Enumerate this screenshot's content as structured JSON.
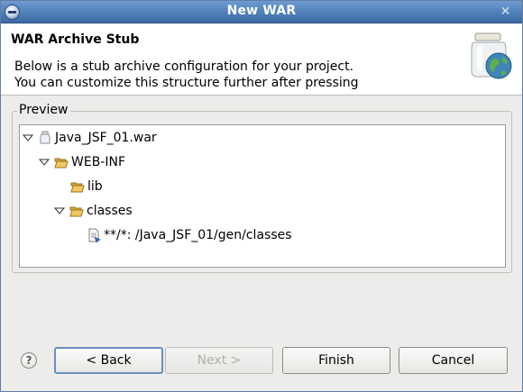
{
  "window": {
    "title": "New WAR"
  },
  "header": {
    "title": "WAR Archive Stub",
    "description_line1": "Below is a stub archive configuration for your project.",
    "description_line2": "You can customize this structure further after pressing",
    "icon": "jar-globe-icon"
  },
  "preview": {
    "label": "Preview",
    "tree": [
      {
        "label": "Java_JSF_01.war",
        "icon": "war-file-icon",
        "expanded": true,
        "depth": 0
      },
      {
        "label": "WEB-INF",
        "icon": "folder-open-icon",
        "expanded": true,
        "depth": 1
      },
      {
        "label": "lib",
        "icon": "folder-icon",
        "expanded": false,
        "depth": 2
      },
      {
        "label": "classes",
        "icon": "folder-open-icon",
        "expanded": true,
        "depth": 2
      },
      {
        "label": "**/*: /Java_JSF_01/gen/classes",
        "icon": "fileset-icon",
        "expanded": false,
        "depth": 3
      }
    ]
  },
  "buttons": {
    "help": "?",
    "back": "< Back",
    "next": "Next >",
    "finish": "Finish",
    "cancel": "Cancel"
  },
  "colors": {
    "title_bar": "#4f7fb9",
    "folder": "#e8b84a",
    "focus": "#6a8fc0"
  }
}
